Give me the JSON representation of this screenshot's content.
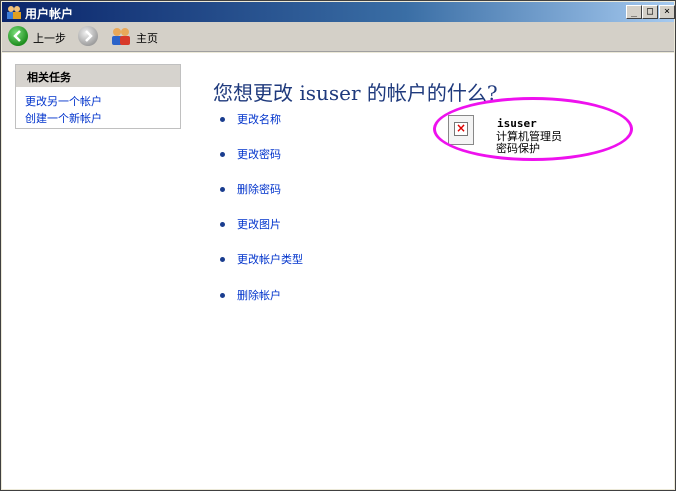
{
  "window": {
    "title": "用户帐户",
    "min_label": "_",
    "max_label": "□",
    "close_label": "×"
  },
  "toolbar": {
    "back_label": "上一步",
    "home_label": "主页"
  },
  "sidebar": {
    "header": "相关任务",
    "links": [
      "更改另一个帐户",
      "创建一个新帐户"
    ]
  },
  "main": {
    "title": "您想更改 isuser 的帐户的什么?",
    "tasks": [
      "更改名称",
      "更改密码",
      "删除密码",
      "更改图片",
      "更改帐户类型",
      "删除帐户"
    ]
  },
  "account": {
    "name": "isuser",
    "type": "计算机管理员",
    "password_status": "密码保护"
  },
  "colors": {
    "link": "#0033cc",
    "title": "#1f3a7d",
    "highlight": "#ee11ee"
  },
  "icons": {
    "back": "back-arrow-icon",
    "forward": "forward-arrow-icon",
    "home": "users-home-icon",
    "picture": "broken-image-icon"
  }
}
